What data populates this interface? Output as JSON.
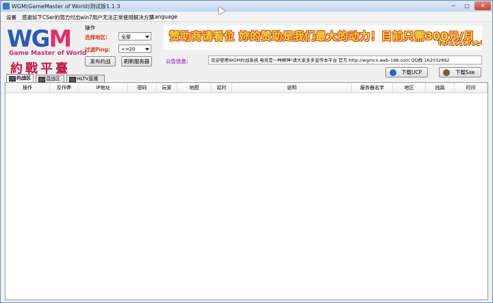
{
  "window": {
    "title": "WGM(GameMaster of World)测试版1.1.3",
    "min": "─",
    "max": "□",
    "close": "✕"
  },
  "menu": [
    "设置",
    "感谢如下CSer的努力付出",
    "win7用户无法正常使用解决方案",
    "Language"
  ],
  "logo": {
    "wgm_left": "WG",
    "wgm_right": "M",
    "subtitle": "Game Master of World",
    "chinese": "約戰平臺"
  },
  "operation": {
    "title": "操作",
    "region_label": "选择地区:",
    "region_value": "全部",
    "ping_label": "过滤Ping:",
    "ping_value": "<=20",
    "post_button": "发布约战",
    "refresh_button": "刷新服务器"
  },
  "banner": {
    "text": "赞助商请看位  妳的赞助是我们最大的动力！目前只需300元/月",
    "tel": "Tel:15157314472"
  },
  "notice": {
    "label": "公告信息:",
    "text": "欢迎使用WGM约战系统 电竞是一种精神!请大家多多宣传本平台 官方:http://wgmcs.web-198.com QQ群:162032892"
  },
  "downloads": {
    "ucp": "下载UCP",
    "sxe": "下载Sxe"
  },
  "tabs": [
    "约战区",
    "混战区",
    "HLTV直播"
  ],
  "columns": [
    "操作",
    "反作弊",
    "IP地址",
    "密码",
    "玩家",
    "地图",
    "延时",
    "说明",
    "服务器名字",
    "地区",
    "线路",
    "时间"
  ],
  "colors": {
    "accent_blue": "#2b5ab8",
    "accent_pink": "#e02f6e",
    "label_red": "#d23a22",
    "notice_purple": "#b050c8"
  }
}
